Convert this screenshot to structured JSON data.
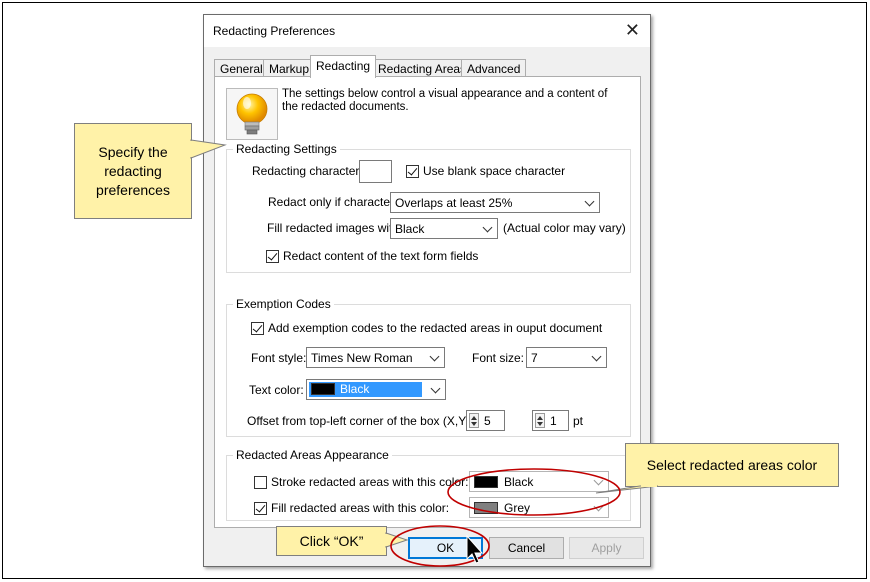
{
  "dialog": {
    "title": "Redacting Preferences",
    "close_glyph": "✕",
    "tabs": [
      "General",
      "Markup",
      "Redacting",
      "Redacting Areas",
      "Advanced"
    ],
    "active_tab": "Redacting",
    "info_text": "The settings below control a visual appearance and a content of the redacted documents.",
    "icon": "lightbulb-icon"
  },
  "redacting_settings": {
    "title": "Redacting Settings",
    "char_label": "Redacting character:",
    "char_value": "",
    "blank_space_label": "Use blank space character",
    "blank_space_checked": true,
    "redact_if_label": "Redact only if character:",
    "redact_if_value": "Overlaps at least 25%",
    "fill_images_label": "Fill redacted images with:",
    "fill_images_value": "Black",
    "fill_images_note": "(Actual color may vary)",
    "form_fields_label": "Redact content of the text form fields",
    "form_fields_checked": true
  },
  "exemption_codes": {
    "title": "Exemption Codes",
    "add_codes_label": "Add exemption codes to the redacted areas in ouput document",
    "add_codes_checked": true,
    "font_style_label": "Font style:",
    "font_style_value": "Times New Roman",
    "font_size_label": "Font size:",
    "font_size_value": "7",
    "text_color_label": "Text color:",
    "text_color_value": "Black",
    "text_color_hex": "#000000",
    "offset_label": "Offset from top-left corner of the box (X,Y):",
    "offset_x": "5",
    "offset_y": "1",
    "offset_unit": "pt"
  },
  "appearance": {
    "title": "Redacted Areas Appearance",
    "stroke_label": "Stroke redacted areas with this color:",
    "stroke_checked": false,
    "stroke_value": "Black",
    "stroke_hex": "#000000",
    "fill_label": "Fill redacted areas with this color:",
    "fill_checked": true,
    "fill_value": "Grey",
    "fill_hex": "#808080"
  },
  "buttons": {
    "ok": "OK",
    "cancel": "Cancel",
    "apply": "Apply"
  },
  "callouts": {
    "specify": "Specify the redacting preferences",
    "select_color": "Select redacted areas color",
    "click_ok": "Click “OK”"
  },
  "colors": {
    "callout_fill": "#fff2a8",
    "highlight_ring": "#c00000",
    "selection_blue": "#3399ff",
    "ok_border": "#0078d7"
  }
}
